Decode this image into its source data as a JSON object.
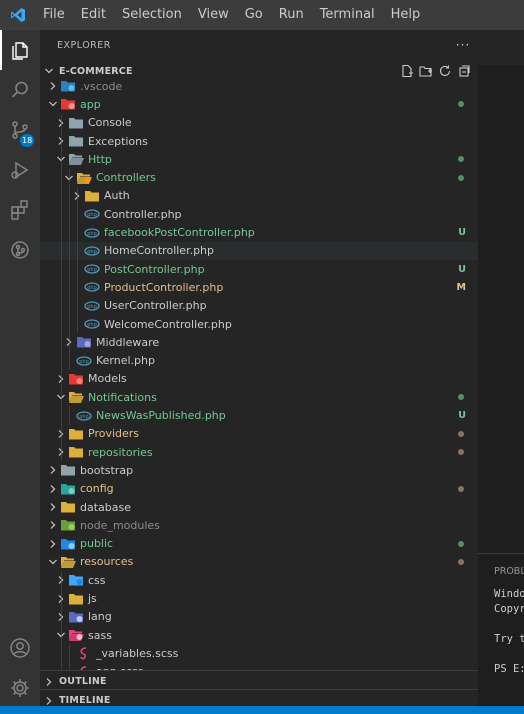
{
  "menu": [
    "File",
    "Edit",
    "Selection",
    "View",
    "Go",
    "Run",
    "Terminal",
    "Help"
  ],
  "activity": {
    "items": [
      "explorer-icon",
      "search-icon",
      "source-control-icon",
      "run-debug-icon",
      "extensions-icon",
      "git-graph-icon"
    ],
    "source_control_badge": "18",
    "bottom": [
      "account-icon",
      "manage-gear-icon"
    ]
  },
  "explorer": {
    "title": "EXPLORER",
    "more": "···",
    "workspace": "E-COMMERCE",
    "actions": [
      "new-file-icon",
      "new-folder-icon",
      "refresh-icon",
      "collapse-all-icon"
    ]
  },
  "tree": [
    {
      "name": ".vscode",
      "level": 1,
      "type": "folder",
      "expanded": false,
      "icon": "vscode-folder",
      "color": "dim"
    },
    {
      "name": "app",
      "level": 1,
      "type": "folder",
      "expanded": true,
      "icon": "app-folder",
      "color": "green",
      "dot": "green"
    },
    {
      "name": "Console",
      "level": 2,
      "type": "folder",
      "expanded": false,
      "icon": "folder"
    },
    {
      "name": "Exceptions",
      "level": 2,
      "type": "folder",
      "expanded": false,
      "icon": "folder"
    },
    {
      "name": "Http",
      "level": 2,
      "type": "folder",
      "expanded": true,
      "icon": "folder-open",
      "color": "green",
      "dot": "green"
    },
    {
      "name": "Controllers",
      "level": 3,
      "type": "folder",
      "expanded": true,
      "icon": "controllers-folder",
      "color": "green",
      "dot": "green"
    },
    {
      "name": "Auth",
      "level": 4,
      "type": "folder",
      "expanded": false,
      "icon": "yellow-folder"
    },
    {
      "name": "Controller.php",
      "level": 4,
      "type": "file",
      "icon": "php"
    },
    {
      "name": "facebookPostController.php",
      "level": 4,
      "type": "file",
      "icon": "php",
      "color": "green",
      "deco": "U"
    },
    {
      "name": "HomeController.php",
      "level": 4,
      "type": "file",
      "icon": "php",
      "hover": true
    },
    {
      "name": "PostController.php",
      "level": 4,
      "type": "file",
      "icon": "php",
      "color": "green",
      "deco": "U"
    },
    {
      "name": "ProductController.php",
      "level": 4,
      "type": "file",
      "icon": "php",
      "color": "yellow",
      "deco": "M"
    },
    {
      "name": "UserController.php",
      "level": 4,
      "type": "file",
      "icon": "php"
    },
    {
      "name": "WelcomeController.php",
      "level": 4,
      "type": "file",
      "icon": "php"
    },
    {
      "name": "Middleware",
      "level": 3,
      "type": "folder",
      "expanded": false,
      "icon": "middleware-folder"
    },
    {
      "name": "Kernel.php",
      "level": 3,
      "type": "file",
      "icon": "php"
    },
    {
      "name": "Models",
      "level": 2,
      "type": "folder",
      "expanded": false,
      "icon": "models-folder"
    },
    {
      "name": "Notifications",
      "level": 2,
      "type": "folder",
      "expanded": true,
      "icon": "yellow-folder-open",
      "color": "green",
      "dot": "green"
    },
    {
      "name": "NewsWasPublished.php",
      "level": 3,
      "type": "file",
      "icon": "php",
      "color": "green",
      "deco": "U"
    },
    {
      "name": "Providers",
      "level": 2,
      "type": "folder",
      "expanded": false,
      "icon": "yellow-folder",
      "color": "yellow",
      "dot": "brown"
    },
    {
      "name": "repositories",
      "level": 2,
      "type": "folder",
      "expanded": false,
      "icon": "yellow-folder",
      "color": "green",
      "dot": "brown"
    },
    {
      "name": "bootstrap",
      "level": 1,
      "type": "folder",
      "expanded": false,
      "icon": "folder"
    },
    {
      "name": "config",
      "level": 1,
      "type": "folder",
      "expanded": false,
      "icon": "config-folder",
      "color": "yellow",
      "dot": "brown"
    },
    {
      "name": "database",
      "level": 1,
      "type": "folder",
      "expanded": false,
      "icon": "yellow-folder"
    },
    {
      "name": "node_modules",
      "level": 1,
      "type": "folder",
      "expanded": false,
      "icon": "node-folder",
      "color": "dim"
    },
    {
      "name": "public",
      "level": 1,
      "type": "folder",
      "expanded": false,
      "icon": "public-folder",
      "color": "green",
      "dot": "green"
    },
    {
      "name": "resources",
      "level": 1,
      "type": "folder",
      "expanded": true,
      "icon": "yellow-folder-open",
      "color": "yellow",
      "dot": "brown"
    },
    {
      "name": "css",
      "level": 2,
      "type": "folder",
      "expanded": false,
      "icon": "css-folder"
    },
    {
      "name": "js",
      "level": 2,
      "type": "folder",
      "expanded": false,
      "icon": "yellow-folder"
    },
    {
      "name": "lang",
      "level": 2,
      "type": "folder",
      "expanded": false,
      "icon": "lang-folder"
    },
    {
      "name": "sass",
      "level": 2,
      "type": "folder",
      "expanded": true,
      "icon": "sass-folder"
    },
    {
      "name": "_variables.scss",
      "level": 3,
      "type": "file",
      "icon": "scss"
    },
    {
      "name": "app.scss",
      "level": 3,
      "type": "file",
      "icon": "scss"
    }
  ],
  "sections": [
    "OUTLINE",
    "TIMELINE"
  ],
  "panel": {
    "tab": "PROBLEMS",
    "lines": [
      "Windows PowerShell",
      "Copyright (C) Microsoft Corporation.",
      "",
      "Try the new cross-platform PowerShell",
      "",
      "PS E:\\"
    ]
  },
  "colors": {
    "accent": "#007acc",
    "git_untracked": "#73c991",
    "git_modified": "#e2c08d",
    "php_icon": "#519aba"
  }
}
